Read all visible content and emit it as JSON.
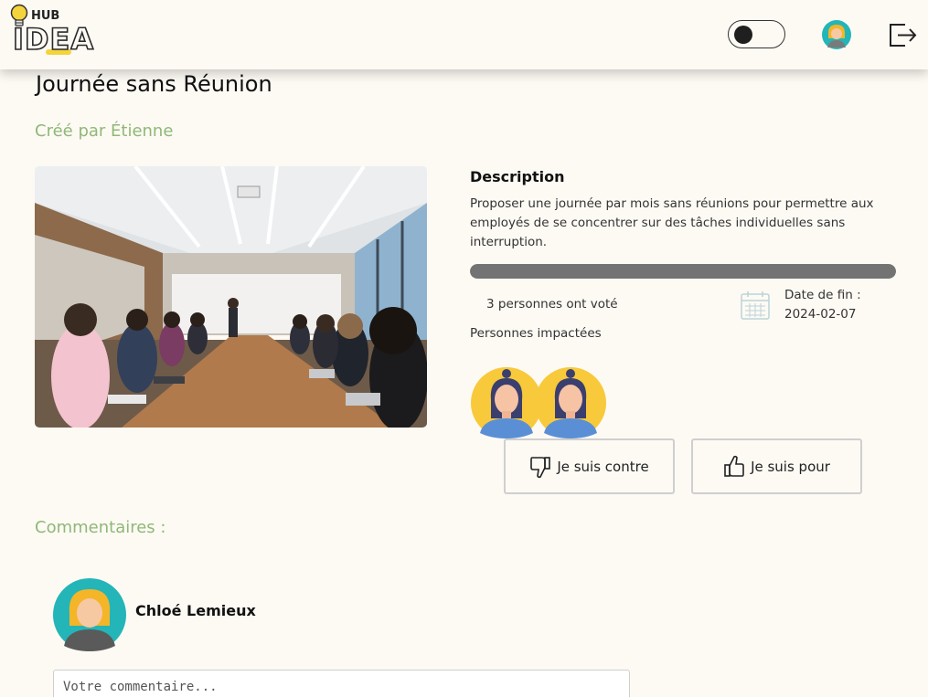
{
  "header": {
    "logo_hub": "HUB",
    "logo_idea": "IDEA",
    "theme_toggle": "dark-mode-toggle",
    "avatar_icon": "user-avatar-icon",
    "logout_icon": "logout-icon"
  },
  "idea": {
    "title": "Journée sans Réunion",
    "author": "Créé par Étienne",
    "image_icon": "meeting-room-photo",
    "description_heading": "Description",
    "description": "Proposer une journée par mois sans réunions pour permettre aux employés de se concentrer sur des tâches individuelles sans interruption.",
    "progress": 1.0,
    "votes_text": "3 personnes ont voté",
    "end_date_label": "Date de fin :",
    "end_date": "2024-02-07",
    "impacted_label": "Personnes impactées",
    "impacted_people": [
      {
        "icon": "woman-avatar-icon"
      },
      {
        "icon": "woman-avatar-icon"
      }
    ]
  },
  "vote": {
    "against_label": "Je suis contre",
    "for_label": "Je suis pour"
  },
  "comments": {
    "heading": "Commentaires :",
    "user_name": "Chloé Lemieux",
    "input_placeholder": "Votre commentaire..."
  },
  "colors": {
    "background": "#fdfaf4",
    "accent_green": "#8fb877",
    "progress_fill": "#737373",
    "logo_yellow": "#f4d43c"
  }
}
